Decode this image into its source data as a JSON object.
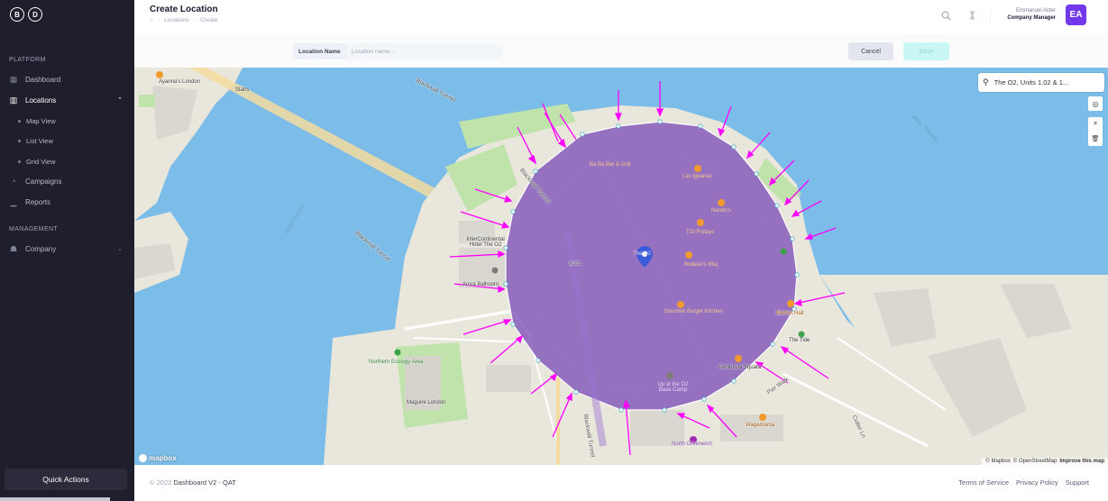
{
  "sidebar": {
    "logo": [
      "B",
      "D"
    ],
    "platform_title": "PLATFORM",
    "management_title": "MANAGEMENT",
    "items": {
      "dashboard": "Dashboard",
      "locations": "Locations",
      "map_view": "Map View",
      "list_view": "List View",
      "grid_view": "Grid View",
      "campaigns": "Campaigns",
      "reports": "Reports",
      "company": "Company"
    },
    "quick_actions": "Quick Actions"
  },
  "header": {
    "title": "Create Location",
    "breadcrumb": [
      "Locations",
      "Create"
    ],
    "user_name": "Emmanuel Alder",
    "user_role": "Company Manager",
    "avatar_initials": "EA"
  },
  "toolbar": {
    "location_label": "Location Name",
    "location_placeholder": "Location name...",
    "location_value": "",
    "cancel_label": "Cancel",
    "save_label": "Save"
  },
  "map": {
    "search_value": "The O2, Units 1.02 & 1...",
    "mapbox_label": "mapbox",
    "attribution": [
      "© Mapbox",
      "© OpenStreetMap",
      "Improve this map"
    ],
    "labels": {
      "ayanna": "Ayanna's London",
      "blackwall_tunnel_1": "Blackwall Tunnel",
      "blackwall_tunnel_2": "Blackwall Tunnel",
      "blackwall_tunnel_3": "Blackwall Tunnel",
      "blackwall_tunnel_4": "Blackwall Tunnel",
      "river_thames_1": "River Thames",
      "river_thames_2": "River Thames",
      "intercontinental": "InterContinental Hotel The O2",
      "arora": "Arora Ballroom",
      "northern_ecology": "Northern Ecology Area",
      "maguire": "Maguire London",
      "ba_ba": "Ba Ba Bar & Grill",
      "las_iguanas": "Las Iguanas",
      "nandos": "Nando's",
      "tgi": "TGI Fridays",
      "bodeanos": "Bodean's Bbq",
      "gourmet": "Gourmet Burger Kitchen",
      "up_at_o2": "Up at the O2 Base Camp",
      "wagamama": "Wagamama",
      "tide": "The Tide",
      "market_hall": "Market Hall",
      "north_greenwich": "North Greenwich",
      "peninsula_sq": "Peninsula Square",
      "pier_walk": "Pier Walk",
      "a102": "A102",
      "o2": "The O2",
      "stairs": "Stairs",
      "cutter_ln": "Cutter Ln"
    }
  },
  "colors": {
    "sidebar_bg": "#1e1e2d",
    "accent": "#7239ea",
    "polygon_fill": "#7e50b8",
    "annotation_arrows": "#ff00ff",
    "water": "#7cbce8",
    "land": "#e9e6dc",
    "park": "#bfe3ab",
    "save_bg": "#c9f7f5"
  },
  "footer": {
    "year": "© 2022",
    "app_name": "Dashboard V2 - QAT",
    "links": [
      "Terms of Service",
      "Privacy Policy",
      "Support"
    ]
  },
  "icons": [
    "home-icon",
    "search-icon",
    "moon-icon",
    "dashboard-icon",
    "map-icon",
    "campaign-icon",
    "reports-icon",
    "company-icon",
    "geolocate-icon",
    "polygon-icon",
    "trash-icon",
    "location-pin-icon"
  ]
}
